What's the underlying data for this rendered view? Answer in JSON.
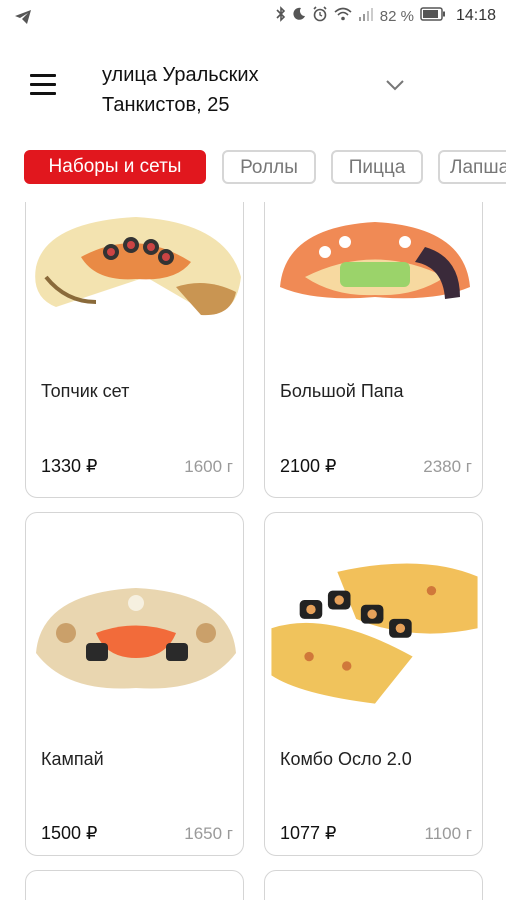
{
  "status_bar": {
    "battery_percent": "82 %",
    "time": "14:18",
    "icons": [
      "telegram-icon",
      "bluetooth-icon",
      "moon-icon",
      "alarm-icon",
      "wifi-icon",
      "signal-icon",
      "battery-icon"
    ]
  },
  "header": {
    "address_line1": "улица Уральских",
    "address_line2": "Танкистов, 25",
    "menu_icon": "hamburger-menu-icon",
    "dropdown_icon": "chevron-down-icon"
  },
  "categories": [
    {
      "label": "Наборы и сеты",
      "active": true
    },
    {
      "label": "Роллы",
      "active": false
    },
    {
      "label": "Пицца",
      "active": false
    },
    {
      "label": "Лапша",
      "active": false
    }
  ],
  "products": [
    {
      "name": "Топчик сет",
      "price": "1330 ₽",
      "weight": "1600 г"
    },
    {
      "name": "Большой Папа",
      "price": "2100 ₽",
      "weight": "2380 г"
    },
    {
      "name": "Кампай",
      "price": "1500 ₽",
      "weight": "1650 г"
    },
    {
      "name": "Комбо Осло 2.0",
      "price": "1077 ₽",
      "weight": "1100 г"
    }
  ],
  "colors": {
    "accent": "#e1171e",
    "chip_border": "#d6d6d6",
    "muted_text": "#9a9a9a"
  }
}
